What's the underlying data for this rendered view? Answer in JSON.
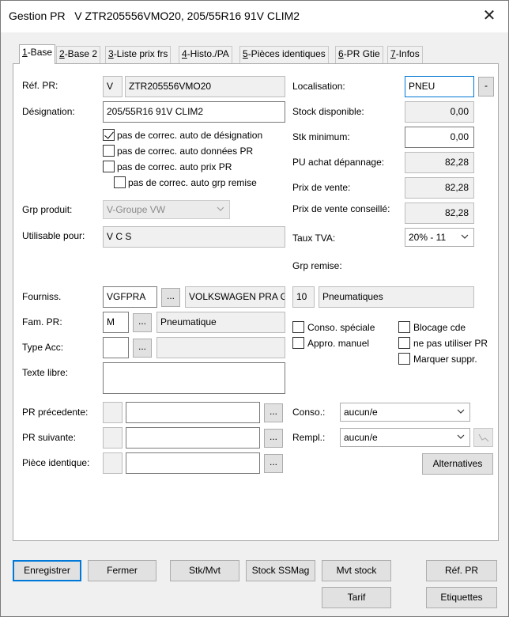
{
  "window": {
    "title": "Gestion PR   V ZTR205556VMO20, 205/55R16 91V CLIM2",
    "close_glyph": "✕"
  },
  "tabs": [
    {
      "key": "1",
      "label": "-Base",
      "active": true
    },
    {
      "key": "2",
      "label": "-Base 2"
    },
    {
      "key": "3",
      "label": "-Liste prix frs"
    },
    {
      "key": "4",
      "label": "-Histo./PA"
    },
    {
      "key": "5",
      "label": "-Pièces identiques"
    },
    {
      "key": "6",
      "label": "-PR Gtie"
    },
    {
      "key": "7",
      "label": "-Infos"
    }
  ],
  "left": {
    "ref_label": "Réf. PR:",
    "ref_prefix": "V",
    "ref_value": "ZTR205556VMO20",
    "designation_label": "Désignation:",
    "designation_value": "205/55R16 91V CLIM2",
    "checks": [
      {
        "label": "pas de correc. auto de désignation",
        "checked": true
      },
      {
        "label": "pas de correc. auto données PR",
        "checked": false
      },
      {
        "label": "pas de correc. auto prix PR",
        "checked": false
      },
      {
        "label": "pas de correc. auto grp remise",
        "checked": false
      }
    ],
    "grp_produit_label": "Grp produit:",
    "grp_produit_value": "V-Groupe VW",
    "utilisable_label": "Utilisable pour:",
    "utilisable_value": "V C S",
    "fourniss_label": "Fourniss.",
    "fourniss_code": "VGFPRA",
    "fourniss_name": "VOLKSWAGEN PRA GMBH",
    "fam_label": "Fam. PR:",
    "fam_code": "M",
    "fam_name": "Pneumatique",
    "type_acc_label": "Type Acc:",
    "type_acc_code": "",
    "type_acc_name": "",
    "texte_libre_label": "Texte libre:",
    "texte_libre_value": "",
    "pr_precedente_label": "PR précedente:",
    "pr_suivante_label": "PR suivante:",
    "piece_identique_label": "Pièce identique:",
    "dots_glyph": "..."
  },
  "right": {
    "localisation_label": "Localisation:",
    "localisation_value": "PNEU",
    "loc_button": "-",
    "stock_dispo_label": "Stock disponible:",
    "stock_dispo_value": "0,00",
    "stk_min_label": "Stk minimum:",
    "stk_min_value": "0,00",
    "pu_achat_label": "PU achat dépannage:",
    "pu_achat_value": "82,28",
    "prix_vente_label": "Prix de vente:",
    "prix_vente_value": "82,28",
    "prix_conseille_label": "Prix de vente conseillé:",
    "prix_conseille_value": "82,28",
    "taux_tva_label": "Taux TVA:",
    "taux_tva_value": "20% - 11",
    "grp_remise_label": "Grp remise:",
    "grp_remise_code": "10",
    "grp_remise_name": "Pneumatiques",
    "checks_left": [
      {
        "label": "Conso. spéciale",
        "checked": false
      },
      {
        "label": "Appro. manuel",
        "checked": false
      }
    ],
    "checks_right": [
      {
        "label": "Blocage cde",
        "checked": false
      },
      {
        "label": "ne pas utiliser PR",
        "checked": false
      },
      {
        "label": "Marquer suppr.",
        "checked": false
      }
    ],
    "conso_label": "Conso.:",
    "conso_value": "aucun/e",
    "rempl_label": "Rempl.:",
    "rempl_value": "aucun/e",
    "alternatives_button": "Alternatives"
  },
  "footer": {
    "enregistrer": "Enregistrer",
    "fermer": "Fermer",
    "stk_mvt": "Stk/Mvt",
    "stock_ssmag": "Stock SSMag",
    "mvt_stock": "Mvt stock",
    "ref_pr": "Réf. PR",
    "tarif": "Tarif",
    "etiquettes": "Etiquettes"
  }
}
